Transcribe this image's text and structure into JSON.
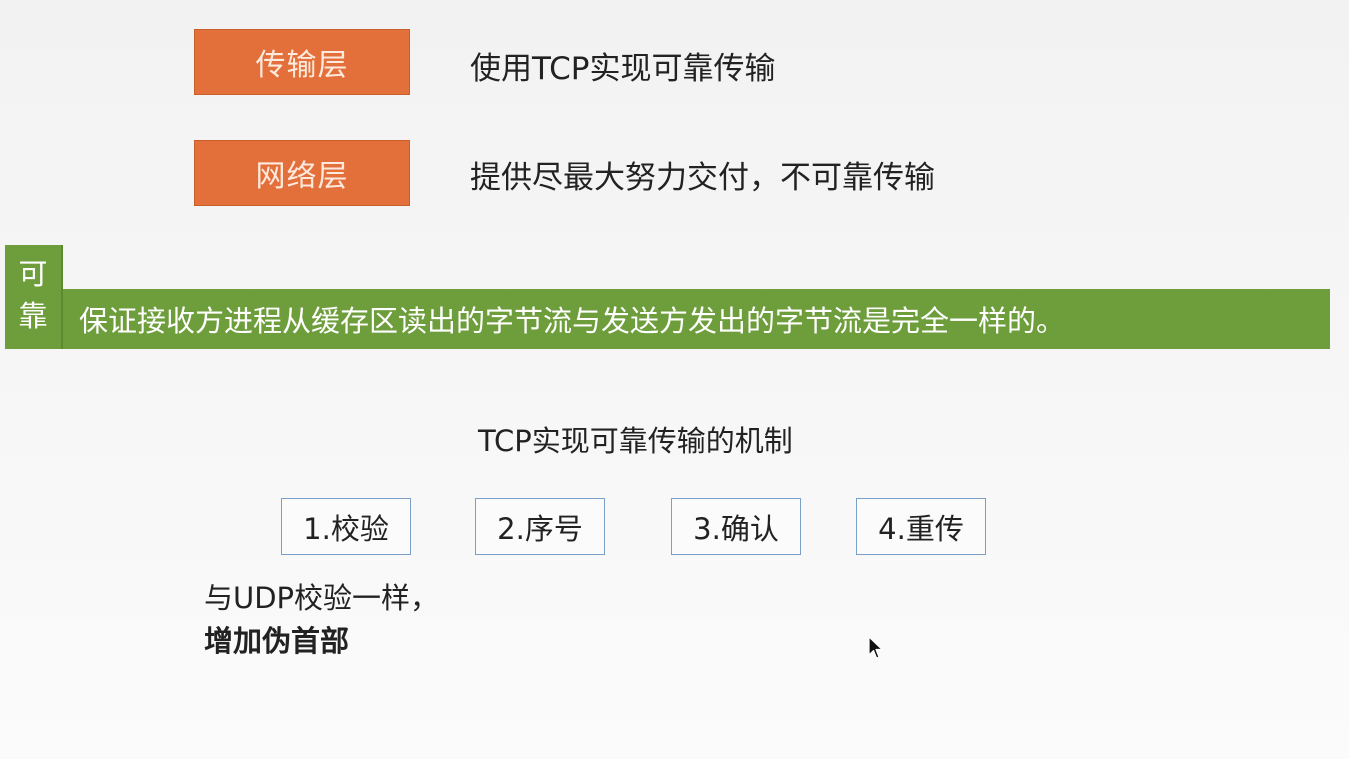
{
  "layers": [
    {
      "name": "传输层",
      "description": "使用TCP实现可靠传输"
    },
    {
      "name": "网络层",
      "description": "提供尽最大努力交付，不可靠传输"
    }
  ],
  "reliability": {
    "tag_chars": [
      "可",
      "靠"
    ],
    "definition": "保证接收方进程从缓存区读出的字节流与发送方发出的字节流是完全一样的。"
  },
  "mechanisms": {
    "title": "TCP实现可靠传输的机制",
    "items": [
      "1.校验",
      "2.序号",
      "3.确认",
      "4.重传"
    ]
  },
  "checksum_note": {
    "line1": "与UDP校验一样，",
    "line2": "增加伪首部"
  },
  "colors": {
    "layer_box": "#e3703a",
    "banner": "#6e9e3c",
    "mechanism_border": "#7aa0c8"
  },
  "icons": {
    "cursor": "mouse-pointer-icon"
  }
}
